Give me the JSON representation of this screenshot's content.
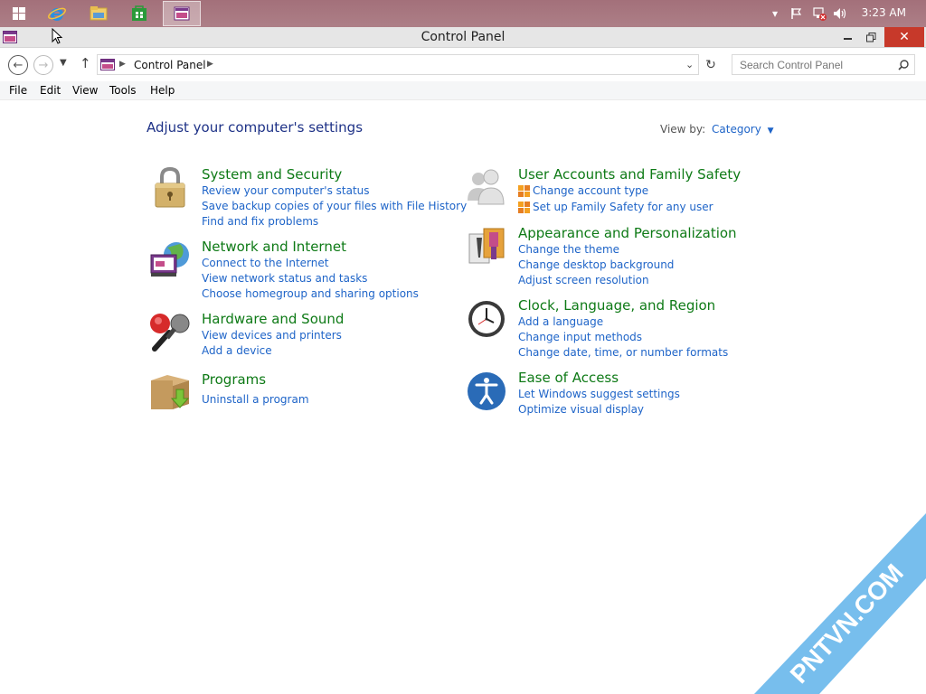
{
  "taskbar": {
    "clock": "3:23 AM",
    "apps": [
      {
        "icon": "windows-start-icon"
      },
      {
        "icon": "internet-explorer-icon"
      },
      {
        "icon": "file-explorer-icon"
      },
      {
        "icon": "store-icon"
      },
      {
        "icon": "control-panel-icon"
      }
    ]
  },
  "window": {
    "title": "Control Panel"
  },
  "address": {
    "crumb": "Control Panel",
    "search_placeholder": "Search Control Panel"
  },
  "menu": {
    "items": [
      "File",
      "Edit",
      "View",
      "Tools",
      "Help"
    ]
  },
  "content": {
    "heading": "Adjust your computer's settings",
    "view_by_label": "View by:",
    "view_by_value": "Category",
    "categories": [
      {
        "title": "System and Security",
        "links": [
          "Review your computer's status",
          "Save backup copies of your files with File History",
          "Find and fix problems"
        ]
      },
      {
        "title": "Network and Internet",
        "links": [
          "Connect to the Internet",
          "View network status and tasks",
          "Choose homegroup and sharing options"
        ]
      },
      {
        "title": "Hardware and Sound",
        "links": [
          "View devices and printers",
          "Add a device"
        ]
      },
      {
        "title": "Programs",
        "links": [
          "Uninstall a program"
        ]
      },
      {
        "title": "User Accounts and Family Safety",
        "links": [
          "Change account type",
          "Set up Family Safety for any user"
        ]
      },
      {
        "title": "Appearance and Personalization",
        "links": [
          "Change the theme",
          "Change desktop background",
          "Adjust screen resolution"
        ]
      },
      {
        "title": "Clock, Language, and Region",
        "links": [
          "Add a language",
          "Change input methods",
          "Change date, time, or number formats"
        ]
      },
      {
        "title": "Ease of Access",
        "links": [
          "Let Windows suggest settings",
          "Optimize visual display"
        ]
      }
    ]
  },
  "watermark": "PNTVN.COM",
  "colors": {
    "category_title": "#0e7a16",
    "link": "#1e64c8",
    "heading": "#1e3287",
    "close_button": "#c7392a"
  }
}
